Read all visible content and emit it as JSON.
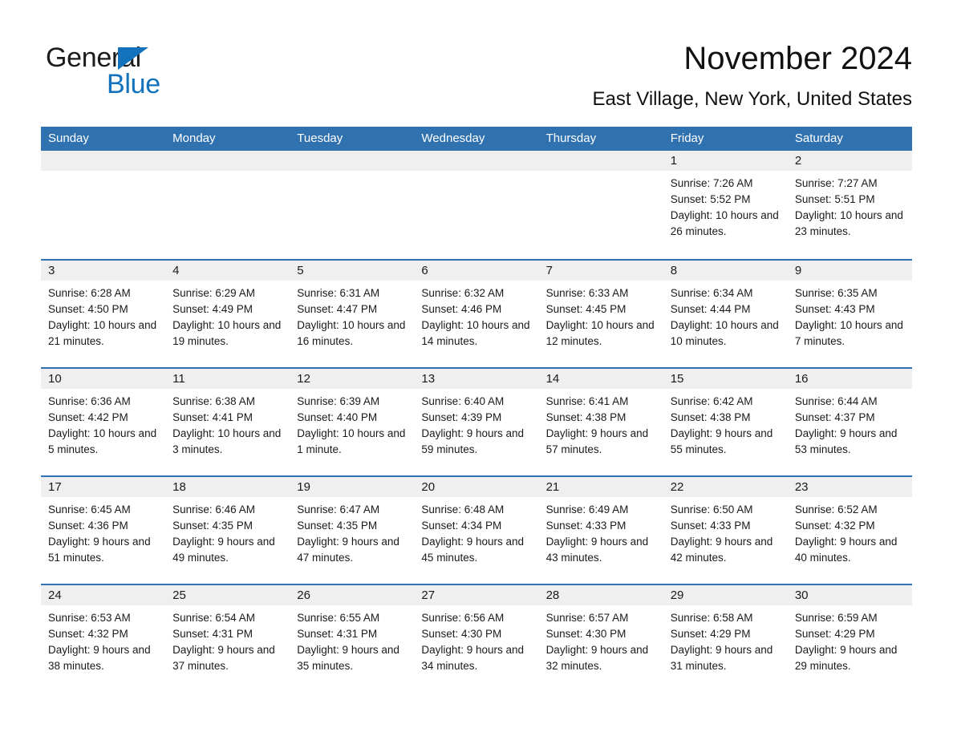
{
  "logo": {
    "word_one": "General",
    "word_two": "Blue",
    "accent_color": "#1272bc"
  },
  "header": {
    "title": "November 2024",
    "location": "East Village, New York, United States",
    "header_bg_color": "#3071b0",
    "day_band_color": "#efefef"
  },
  "weekdays": [
    "Sunday",
    "Monday",
    "Tuesday",
    "Wednesday",
    "Thursday",
    "Friday",
    "Saturday"
  ],
  "labels": {
    "sunrise_prefix": "Sunrise:",
    "sunset_prefix": "Sunset:",
    "daylight_prefix": "Daylight:"
  },
  "weeks": [
    [
      {
        "day": "",
        "empty": true
      },
      {
        "day": "",
        "empty": true
      },
      {
        "day": "",
        "empty": true
      },
      {
        "day": "",
        "empty": true
      },
      {
        "day": "",
        "empty": true
      },
      {
        "day": "1",
        "sunrise": "Sunrise: 7:26 AM",
        "sunset": "Sunset: 5:52 PM",
        "daylight": "Daylight: 10 hours and 26 minutes."
      },
      {
        "day": "2",
        "sunrise": "Sunrise: 7:27 AM",
        "sunset": "Sunset: 5:51 PM",
        "daylight": "Daylight: 10 hours and 23 minutes."
      }
    ],
    [
      {
        "day": "3",
        "sunrise": "Sunrise: 6:28 AM",
        "sunset": "Sunset: 4:50 PM",
        "daylight": "Daylight: 10 hours and 21 minutes."
      },
      {
        "day": "4",
        "sunrise": "Sunrise: 6:29 AM",
        "sunset": "Sunset: 4:49 PM",
        "daylight": "Daylight: 10 hours and 19 minutes."
      },
      {
        "day": "5",
        "sunrise": "Sunrise: 6:31 AM",
        "sunset": "Sunset: 4:47 PM",
        "daylight": "Daylight: 10 hours and 16 minutes."
      },
      {
        "day": "6",
        "sunrise": "Sunrise: 6:32 AM",
        "sunset": "Sunset: 4:46 PM",
        "daylight": "Daylight: 10 hours and 14 minutes."
      },
      {
        "day": "7",
        "sunrise": "Sunrise: 6:33 AM",
        "sunset": "Sunset: 4:45 PM",
        "daylight": "Daylight: 10 hours and 12 minutes."
      },
      {
        "day": "8",
        "sunrise": "Sunrise: 6:34 AM",
        "sunset": "Sunset: 4:44 PM",
        "daylight": "Daylight: 10 hours and 10 minutes."
      },
      {
        "day": "9",
        "sunrise": "Sunrise: 6:35 AM",
        "sunset": "Sunset: 4:43 PM",
        "daylight": "Daylight: 10 hours and 7 minutes."
      }
    ],
    [
      {
        "day": "10",
        "sunrise": "Sunrise: 6:36 AM",
        "sunset": "Sunset: 4:42 PM",
        "daylight": "Daylight: 10 hours and 5 minutes."
      },
      {
        "day": "11",
        "sunrise": "Sunrise: 6:38 AM",
        "sunset": "Sunset: 4:41 PM",
        "daylight": "Daylight: 10 hours and 3 minutes."
      },
      {
        "day": "12",
        "sunrise": "Sunrise: 6:39 AM",
        "sunset": "Sunset: 4:40 PM",
        "daylight": "Daylight: 10 hours and 1 minute."
      },
      {
        "day": "13",
        "sunrise": "Sunrise: 6:40 AM",
        "sunset": "Sunset: 4:39 PM",
        "daylight": "Daylight: 9 hours and 59 minutes."
      },
      {
        "day": "14",
        "sunrise": "Sunrise: 6:41 AM",
        "sunset": "Sunset: 4:38 PM",
        "daylight": "Daylight: 9 hours and 57 minutes."
      },
      {
        "day": "15",
        "sunrise": "Sunrise: 6:42 AM",
        "sunset": "Sunset: 4:38 PM",
        "daylight": "Daylight: 9 hours and 55 minutes."
      },
      {
        "day": "16",
        "sunrise": "Sunrise: 6:44 AM",
        "sunset": "Sunset: 4:37 PM",
        "daylight": "Daylight: 9 hours and 53 minutes."
      }
    ],
    [
      {
        "day": "17",
        "sunrise": "Sunrise: 6:45 AM",
        "sunset": "Sunset: 4:36 PM",
        "daylight": "Daylight: 9 hours and 51 minutes."
      },
      {
        "day": "18",
        "sunrise": "Sunrise: 6:46 AM",
        "sunset": "Sunset: 4:35 PM",
        "daylight": "Daylight: 9 hours and 49 minutes."
      },
      {
        "day": "19",
        "sunrise": "Sunrise: 6:47 AM",
        "sunset": "Sunset: 4:35 PM",
        "daylight": "Daylight: 9 hours and 47 minutes."
      },
      {
        "day": "20",
        "sunrise": "Sunrise: 6:48 AM",
        "sunset": "Sunset: 4:34 PM",
        "daylight": "Daylight: 9 hours and 45 minutes."
      },
      {
        "day": "21",
        "sunrise": "Sunrise: 6:49 AM",
        "sunset": "Sunset: 4:33 PM",
        "daylight": "Daylight: 9 hours and 43 minutes."
      },
      {
        "day": "22",
        "sunrise": "Sunrise: 6:50 AM",
        "sunset": "Sunset: 4:33 PM",
        "daylight": "Daylight: 9 hours and 42 minutes."
      },
      {
        "day": "23",
        "sunrise": "Sunrise: 6:52 AM",
        "sunset": "Sunset: 4:32 PM",
        "daylight": "Daylight: 9 hours and 40 minutes."
      }
    ],
    [
      {
        "day": "24",
        "sunrise": "Sunrise: 6:53 AM",
        "sunset": "Sunset: 4:32 PM",
        "daylight": "Daylight: 9 hours and 38 minutes."
      },
      {
        "day": "25",
        "sunrise": "Sunrise: 6:54 AM",
        "sunset": "Sunset: 4:31 PM",
        "daylight": "Daylight: 9 hours and 37 minutes."
      },
      {
        "day": "26",
        "sunrise": "Sunrise: 6:55 AM",
        "sunset": "Sunset: 4:31 PM",
        "daylight": "Daylight: 9 hours and 35 minutes."
      },
      {
        "day": "27",
        "sunrise": "Sunrise: 6:56 AM",
        "sunset": "Sunset: 4:30 PM",
        "daylight": "Daylight: 9 hours and 34 minutes."
      },
      {
        "day": "28",
        "sunrise": "Sunrise: 6:57 AM",
        "sunset": "Sunset: 4:30 PM",
        "daylight": "Daylight: 9 hours and 32 minutes."
      },
      {
        "day": "29",
        "sunrise": "Sunrise: 6:58 AM",
        "sunset": "Sunset: 4:29 PM",
        "daylight": "Daylight: 9 hours and 31 minutes."
      },
      {
        "day": "30",
        "sunrise": "Sunrise: 6:59 AM",
        "sunset": "Sunset: 4:29 PM",
        "daylight": "Daylight: 9 hours and 29 minutes."
      }
    ]
  ]
}
